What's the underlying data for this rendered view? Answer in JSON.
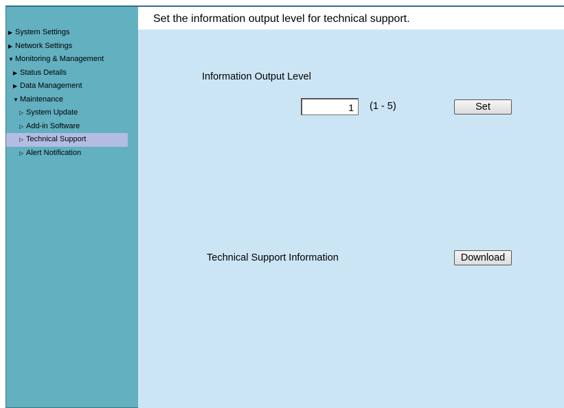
{
  "sidebar": {
    "items": [
      {
        "label": "System Settings",
        "arrow": "▶"
      },
      {
        "label": "Network Settings",
        "arrow": "▶"
      },
      {
        "label": "Monitoring & Management",
        "arrow": "▼"
      },
      {
        "label": "Status Details",
        "arrow": "▶"
      },
      {
        "label": "Data Management",
        "arrow": "▶"
      },
      {
        "label": "Maintenance",
        "arrow": "▼"
      },
      {
        "label": "System Update",
        "arrow": "▷"
      },
      {
        "label": "Add-in Software",
        "arrow": "▷"
      },
      {
        "label": "Technical Support",
        "arrow": "▷"
      },
      {
        "label": "Alert Notification",
        "arrow": "▷"
      }
    ],
    "active_item": "Technical Support"
  },
  "main": {
    "description": "Set the information output level for technical support.",
    "output_level": {
      "label": "Information Output Level",
      "value": "1",
      "range": "(1 - 5)",
      "set_label": "Set"
    },
    "tech_support": {
      "label": "Technical Support Information",
      "download_label": "Download"
    }
  },
  "colors": {
    "sidebar_bg": "#62b0c0",
    "main_bg": "#cce5f4",
    "active_bg": "#b3bde3"
  }
}
